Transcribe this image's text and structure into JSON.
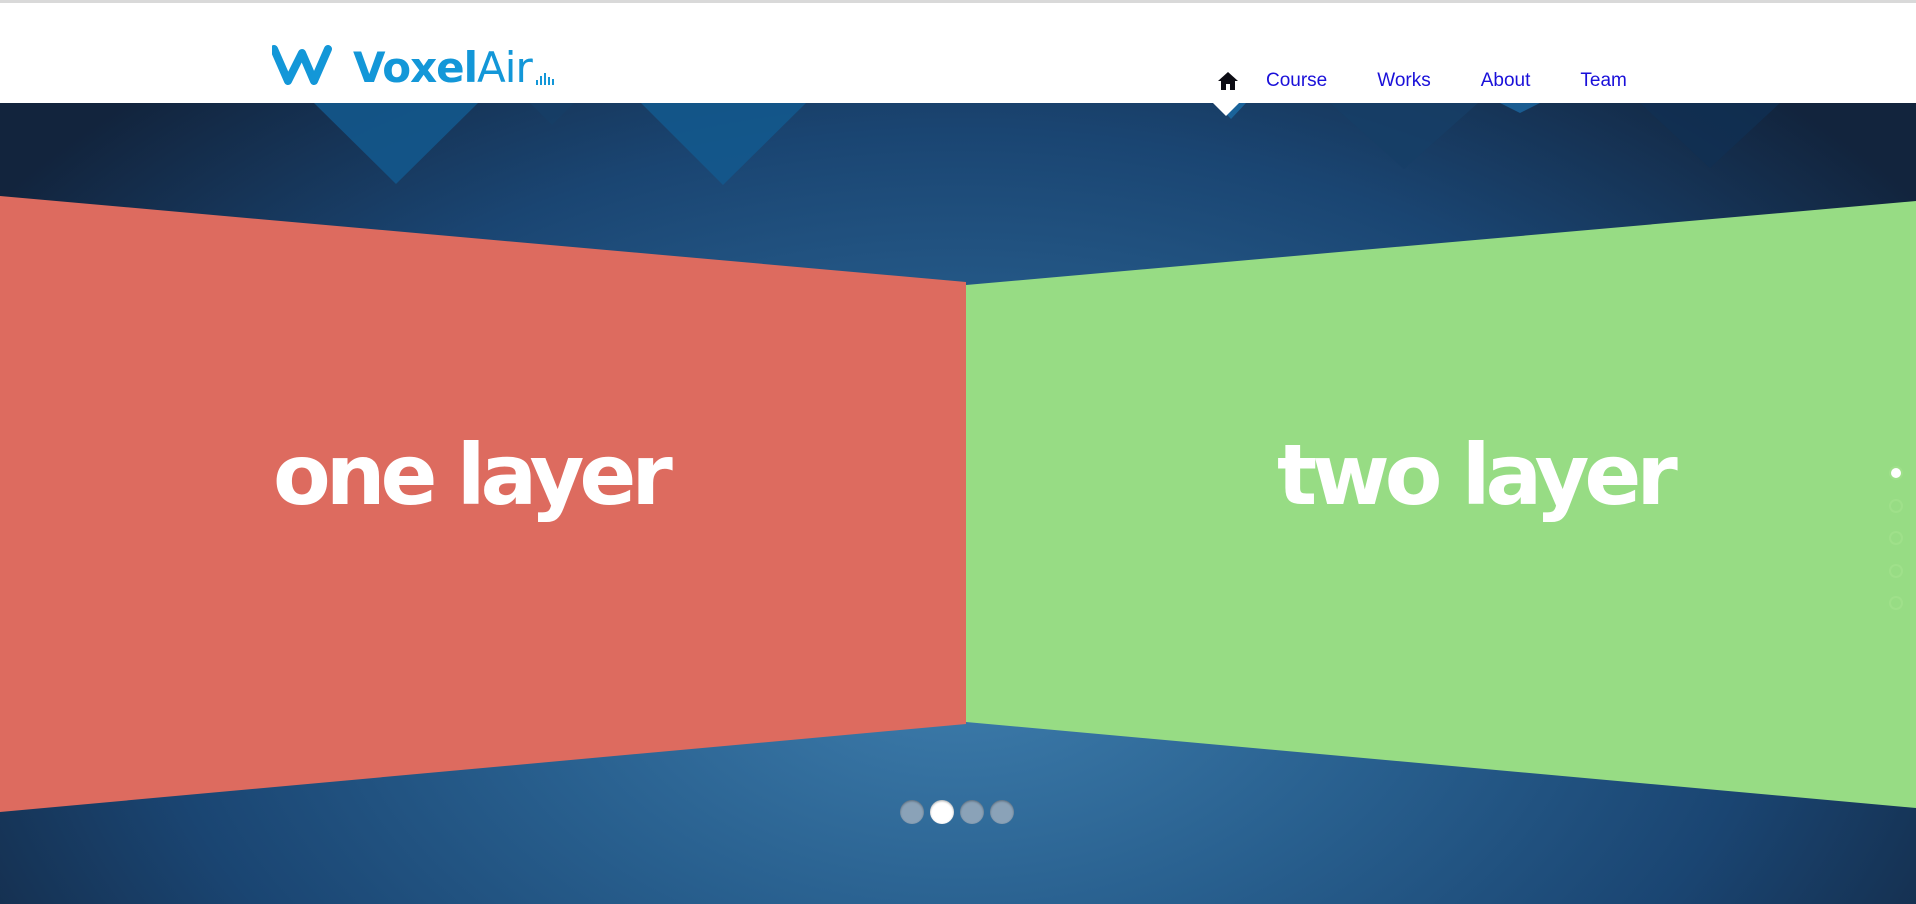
{
  "brand": {
    "name_bold": "Voxel",
    "name_light": "Air",
    "accent_color": "#1397d8"
  },
  "nav": {
    "home_icon": "home-icon",
    "items": [
      {
        "label": "Course"
      },
      {
        "label": "Works"
      },
      {
        "label": "About"
      },
      {
        "label": "Team"
      }
    ],
    "link_color": "#1a10d9"
  },
  "slider": {
    "panels": [
      {
        "text": "one layer",
        "color": "#dd6b5f"
      },
      {
        "text": "two layer",
        "color": "#97dc84"
      }
    ],
    "pagination_count": 4,
    "pagination_active_index": 1,
    "side_pagination_count": 5,
    "side_pagination_active_index": 0,
    "side_pagination_color": "#9fe08a"
  }
}
